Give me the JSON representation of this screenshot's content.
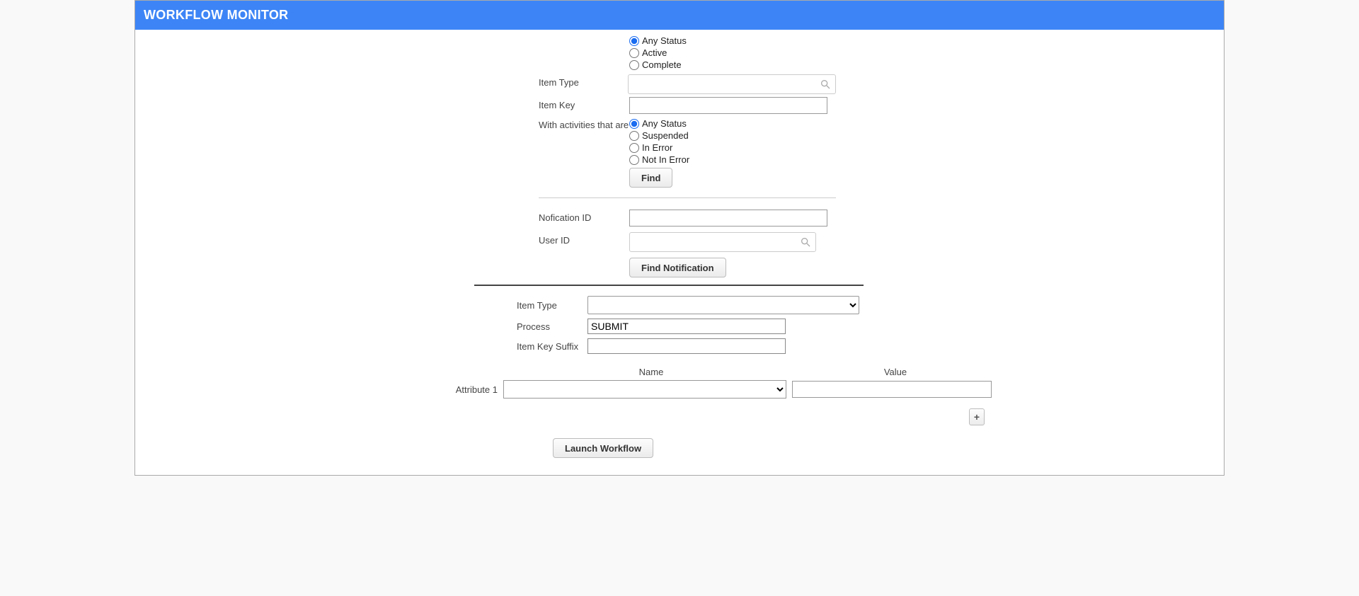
{
  "header": {
    "title": "WORKFLOW MONITOR"
  },
  "section1": {
    "status": {
      "options": [
        "Any Status",
        "Active",
        "Complete"
      ],
      "selected_index": 0
    },
    "item_type_label": "Item Type",
    "item_type_value": "",
    "item_key_label": "Item Key",
    "item_key_value": "",
    "activities_label": "With activities that are",
    "activities": {
      "options": [
        "Any Status",
        "Suspended",
        "In Error",
        "Not In Error"
      ],
      "selected_index": 0
    },
    "find_label": "Find",
    "notification_id_label": "Nofication ID",
    "notification_id_value": "",
    "user_id_label": "User ID",
    "user_id_value": "",
    "find_notification_label": "Find Notification"
  },
  "section2": {
    "item_type_label": "Item Type",
    "item_type_value": "",
    "process_label": "Process",
    "process_value": "SUBMIT",
    "item_key_suffix_label": "Item Key Suffix",
    "item_key_suffix_value": ""
  },
  "attributes": {
    "header_name": "Name",
    "header_value": "Value",
    "rows": [
      {
        "label": "Attribute 1",
        "name": "",
        "value": ""
      }
    ],
    "add_row_label": "+"
  },
  "actions": {
    "launch_label": "Launch Workflow"
  }
}
